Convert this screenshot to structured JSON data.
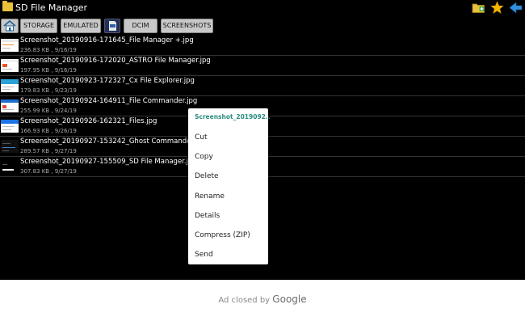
{
  "app": {
    "title": "SD File Manager"
  },
  "path_buttons": [
    "STORAGE",
    "EMULATED",
    "DCIM",
    "SCREENSHOTS"
  ],
  "files": [
    {
      "name": "Screenshot_20190916-171645_File Manager +.jpg",
      "meta": "236.83 KB , 9/16/19"
    },
    {
      "name": "Screenshot_20190916-172020_ASTRO File Manager.jpg",
      "meta": "197.95 KB , 9/16/19"
    },
    {
      "name": "Screenshot_20190923-172327_Cx File Explorer.jpg",
      "meta": "179.83 KB , 9/23/19"
    },
    {
      "name": "Screenshot_20190924-164911_File Commander.jpg",
      "meta": "255.99 KB , 9/24/19"
    },
    {
      "name": "Screenshot_20190926-162321_Files.jpg",
      "meta": "166.93 KB , 9/26/19"
    },
    {
      "name": "Screenshot_20190927-153242_Ghost Commander.jpg",
      "meta": "289.57 KB , 9/27/19"
    },
    {
      "name": "Screenshot_20190927-155509_SD File Manager.jpg",
      "meta": "307.83 KB , 9/27/19"
    }
  ],
  "context_menu": {
    "title": "Screenshot_2019092..",
    "items": [
      "Cut",
      "Copy",
      "Delete",
      "Rename",
      "Details",
      "Compress (ZIP)",
      "Send"
    ]
  },
  "ad": {
    "text": "Ad closed by",
    "brand": "Google"
  },
  "colors": {
    "accent": "#2a8d7d",
    "folder": "#e8c23a",
    "star": "#f4b400",
    "back": "#2f8fde"
  },
  "icons": [
    "folder-icon",
    "new-folder-icon",
    "star-icon",
    "back-arrow-icon",
    "home-icon",
    "sd-card-icon"
  ]
}
